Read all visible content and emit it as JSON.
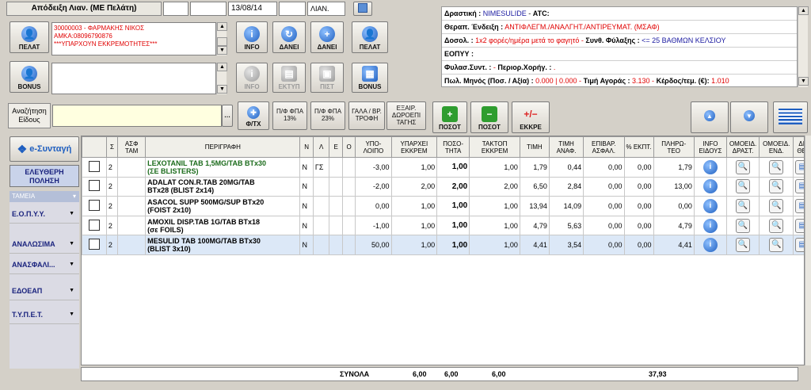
{
  "header": {
    "title": "Απόδειξη Λιαν. (ΜΕ Πελάτη)",
    "date": "13/08/14",
    "code": "ΛΙΑΝ."
  },
  "customer": {
    "line1": "30000003 - ΦΑΡΜΑΚΗΣ ΝΙΚΟΣ",
    "line2": "ΑΜΚΑ:08096790876",
    "line3": "***ΥΠΑΡΧΟΥΝ ΕΚΚΡΕΜΟΤΗΤΕΣ***"
  },
  "buttons": {
    "pelat": "ΠΕΛΑΤ",
    "info": "INFO",
    "danei1": "ΔΑΝΕΙ",
    "danei2": "ΔΑΝΕΙ",
    "pelat2": "ΠΕΛΑΤ",
    "bonus": "BONUS",
    "info2": "INFO",
    "ekt": "ΕΚΤΥΠ",
    "pist": "ΠΙΣΤ",
    "bonus2": "BONUS",
    "ftx": "Φ/ΤΧ",
    "fpa13": "Π/Φ ΦΠΑ 13%",
    "fpa23": "Π/Φ ΦΠΑ 23%",
    "gala": "ΓΑΛΑ / ΒΡ. ΤΡΟΦΗ",
    "exairet": "ΕΞΑΙΡ. ΔΩΡΟΕΠΙ ΤΑΓΗΣ",
    "poson1": "ΠΟΣΟΤ",
    "poson2": "ΠΟΣΟΤ",
    "ekkre": "ΕΚΚΡΕ",
    "search_label": "Αναζήτηση Είδους",
    "esyntagi": "e-Συνταγή",
    "eleftheri": "ΕΛΕΥΘΕΡΗ ΠΟΛΗΣΗ"
  },
  "infopanel": {
    "drastiki_label": "Δραστική :",
    "drastiki": "NIMESULIDE",
    "atc": "ATC:",
    "endeixi_label": "Θεραπ. Ένδειξη :",
    "endeixi": "ΑΝΤΙΦΛΕΓΜ./ΑΝΑΛΓΗΤ./ΑΝΤΙΡΕΥΜΑΤ. (ΜΣΑΦ)",
    "dosol_label": "Δοσολ. :",
    "dosol": "1x2 φορές/ημέρα μετά το φαγητό -",
    "fylaxis_label": "Συνθ. Φύλαξης :",
    "fylaxis": "<= 25 ΒΑΘΜΩΝ ΚΕΛΣΙΟΥ",
    "eopyy": "ΕΟΠΥΥ :",
    "fylasynt_label": "Φυλασ.Συντ. :",
    "fylasynt": "-",
    "perior_label": "Περιορ.Χορήγ. :",
    "perior": ".",
    "pol_label": "Πωλ. Μηνός (Ποσ. / Αξία) :",
    "pol": "0.000 | 0.000 -",
    "timi_label": "Τιμή Αγοράς :",
    "timi": "3.130 -",
    "kerdos_label": "Κέρδος/τεμ. (€):",
    "kerdos": "1.010"
  },
  "sidebar": {
    "header": "ΤΑΜΕΙΑ",
    "items": [
      "Ε.Ο.Π.Υ.Υ.",
      "ΑΝΑΛΩΣΙΜΑ",
      "ΑΝΑΣΦΑΛΙ...",
      "ΕΔΟΕΑΠ",
      "Τ.Υ.Π.Ε.Τ."
    ]
  },
  "table": {
    "headers": [
      "",
      "Σ",
      "ΑΣΦ ΤΑΜ",
      "ΠΕΡΙΓΡΑΦΗ",
      "Ν",
      "Λ",
      "Ε",
      "Ο",
      "ΥΠΟ- ΛΟΙΠΟ",
      "ΥΠΑΡΧΕΙ ΕΚΚΡΕΜ",
      "ΠΟΣΟ- ΤΗΤΑ",
      "ΤΑΚΤΟΠ ΕΚΚΡΕΜ",
      "ΤΙΜΗ",
      "ΤΙΜΗ ΑΝΑΦ.",
      "ΕΠΙΒΑΡ. ΑΣΦΑΛ.",
      "% ΕΚΠΤ.",
      "ΠΛΗΡΩ- ΤΕΟ",
      "INFO ΕΙΔΟΥΣ",
      "ΟΜΟΕΙΔ. ΔΡΑΣΤ.",
      "ΟΜΟΕΙΔ. ΕΝΔ.",
      "ΔΙ ΘΕ"
    ],
    "rows": [
      {
        "s": "2",
        "desc1": "LEXOTANIL TAB 1,5MG/TAB BTx30",
        "desc2": "(ΣΕ BLISTERS)",
        "n": "N",
        "l": "ΓΣ",
        "e": "",
        "o": "",
        "ypol": "-3,00",
        "ypar": "1,00",
        "pos": "1,00",
        "takt": "1,00",
        "timi": "1,79",
        "anaf": "0,44",
        "epib": "0,00",
        "ekpt": "0,00",
        "plir": "1,79",
        "green": true
      },
      {
        "s": "2",
        "desc1": "ADALAT CON.R.TAB 20MG/TAB",
        "desc2": "BTx28 (BLIST 2x14)",
        "n": "N",
        "l": "",
        "e": "",
        "o": "",
        "ypol": "-2,00",
        "ypar": "2,00",
        "pos": "2,00",
        "takt": "2,00",
        "timi": "6,50",
        "anaf": "2,84",
        "epib": "0,00",
        "ekpt": "0,00",
        "plir": "13,00",
        "green": false
      },
      {
        "s": "2",
        "desc1": "ASACOL SUPP 500MG/SUP BTx20",
        "desc2": "(FOIST 2x10)",
        "n": "N",
        "l": "",
        "e": "",
        "o": "",
        "ypol": "0,00",
        "ypar": "1,00",
        "pos": "1,00",
        "takt": "1,00",
        "timi": "13,94",
        "anaf": "14,09",
        "epib": "0,00",
        "ekpt": "0,00",
        "plir": "0,00",
        "green": false
      },
      {
        "s": "2",
        "desc1": "AMOXIL DISP.TAB 1G/TAB BTx18",
        "desc2": "(σε FOILS)",
        "n": "N",
        "l": "",
        "e": "",
        "o": "",
        "ypol": "-1,00",
        "ypar": "1,00",
        "pos": "1,00",
        "takt": "1,00",
        "timi": "4,79",
        "anaf": "5,63",
        "epib": "0,00",
        "ekpt": "0,00",
        "plir": "4,79",
        "green": false
      },
      {
        "s": "2",
        "desc1": "MESULID TAB 100MG/TAB BTx30",
        "desc2": "(BLIST 3x10)",
        "n": "N",
        "l": "",
        "e": "",
        "o": "",
        "ypol": "50,00",
        "ypar": "1,00",
        "pos": "1,00",
        "takt": "1,00",
        "timi": "4,41",
        "anaf": "3,54",
        "epib": "0,00",
        "ekpt": "0,00",
        "plir": "4,41",
        "green": false,
        "sel": true
      }
    ]
  },
  "totals": {
    "label": "ΣΥΝΟΛΑ",
    "ypar": "6,00",
    "pos": "6,00",
    "takt": "6,00",
    "plir": "37,93"
  }
}
